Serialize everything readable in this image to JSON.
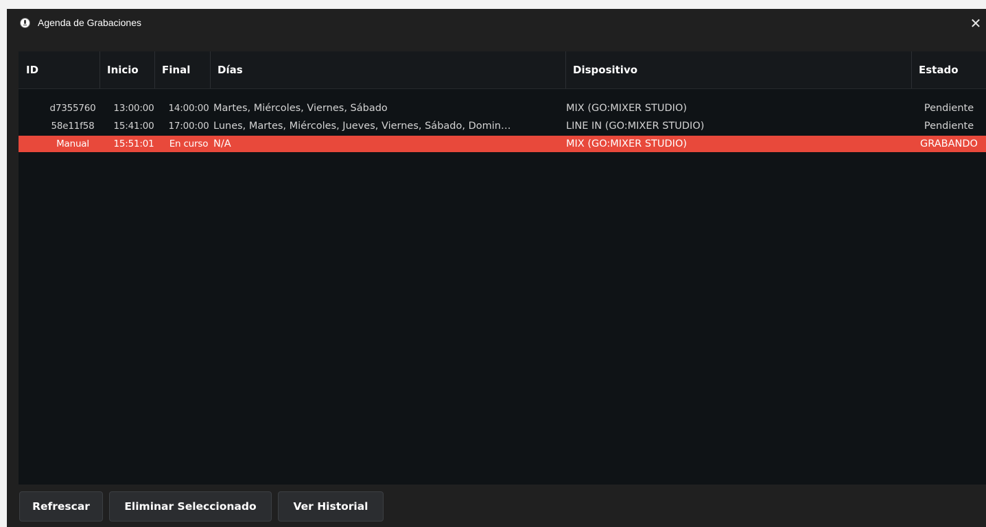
{
  "window": {
    "title": "Agenda de Grabaciones",
    "close_symbol": "✕"
  },
  "table": {
    "columns": [
      "ID",
      "Inicio",
      "Final",
      "Días",
      "Dispositivo",
      "Estado"
    ],
    "rows": [
      {
        "id": "d7355760",
        "inicio": "13:00:00",
        "final": "14:00:00",
        "dias": "Martes, Miércoles, Viernes, Sábado",
        "dispositivo": "MIX (GO:MIXER STUDIO)",
        "estado": "Pendiente",
        "selected": false
      },
      {
        "id": "58e11f58",
        "inicio": "15:41:00",
        "final": "17:00:00",
        "dias": "Lunes, Martes, Miércoles, Jueves, Viernes, Sábado, Domin…",
        "dispositivo": "LINE IN (GO:MIXER STUDIO)",
        "estado": "Pendiente",
        "selected": false
      },
      {
        "id": "Manual",
        "inicio": "15:51:01",
        "final": "En curso",
        "dias": "N/A",
        "dispositivo": "MIX (GO:MIXER STUDIO)",
        "estado": "GRABANDO",
        "selected": true
      }
    ]
  },
  "buttons": {
    "refresh": "Refrescar",
    "delete_selected": "Eliminar Seleccionado",
    "history": "Ver Historial"
  },
  "colors": {
    "window_bg": "#202020",
    "table_bg": "#0f1316",
    "header_bg": "#16191c",
    "selected_row": "#e8493b",
    "button_bg": "#2b2d30"
  },
  "icons": {
    "app": "microphone-icon",
    "close": "close-icon"
  }
}
